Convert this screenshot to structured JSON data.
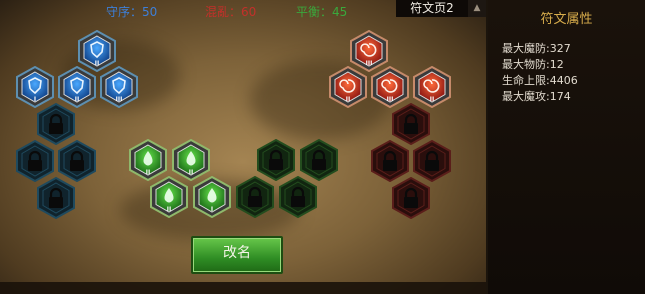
{
  "header": {
    "order_text": "守序：50",
    "chaos_text": "混亂：60",
    "balance_text": "平衡：45",
    "page_tab": "符文页2",
    "scroll_glyph": "▲"
  },
  "panel": {
    "title": "符文属性",
    "attributes": [
      {
        "text": "最大魔防:327"
      },
      {
        "text": "最大物防:12"
      },
      {
        "text": "生命上限:4406"
      },
      {
        "text": "最大魔攻:174"
      }
    ]
  },
  "button": {
    "rename": "改名"
  },
  "colors": {
    "order": "#3d7fd8",
    "chaos": "#c3302a",
    "balance": "#3aa83c",
    "panel_title": "#d8ad4c"
  },
  "slots": {
    "blue": [
      {
        "state": "rune",
        "rank": "II",
        "icon": "blue-shield-rune-icon"
      },
      {
        "state": "rune",
        "rank": "I",
        "icon": "blue-shield-rune-icon"
      },
      {
        "state": "rune",
        "rank": "II",
        "icon": "blue-shield-rune-icon"
      },
      {
        "state": "rune",
        "rank": "III",
        "icon": "blue-shield-rune-icon"
      },
      {
        "state": "locked",
        "icon": "lock-icon"
      },
      {
        "state": "locked",
        "icon": "lock-icon"
      },
      {
        "state": "locked",
        "icon": "lock-icon"
      },
      {
        "state": "locked",
        "icon": "lock-icon"
      }
    ],
    "green": [
      {
        "state": "rune",
        "rank": "II",
        "icon": "green-drop-rune-icon"
      },
      {
        "state": "rune",
        "rank": "II",
        "icon": "green-drop-rune-icon"
      },
      {
        "state": "rune",
        "rank": "II",
        "icon": "green-drop-rune-icon"
      },
      {
        "state": "rune",
        "rank": "I",
        "icon": "green-drop-rune-icon"
      },
      {
        "state": "locked",
        "icon": "lock-icon"
      },
      {
        "state": "locked",
        "icon": "lock-icon"
      },
      {
        "state": "locked",
        "icon": "lock-icon"
      },
      {
        "state": "locked",
        "icon": "lock-icon"
      }
    ],
    "red": [
      {
        "state": "rune",
        "rank": "III",
        "icon": "red-swirl-rune-icon"
      },
      {
        "state": "rune",
        "rank": "II",
        "icon": "red-swirl-rune-icon"
      },
      {
        "state": "rune",
        "rank": "III",
        "icon": "red-swirl-rune-icon"
      },
      {
        "state": "rune",
        "rank": "II",
        "icon": "red-swirl-rune-icon"
      },
      {
        "state": "locked",
        "icon": "lock-icon"
      },
      {
        "state": "locked",
        "icon": "lock-icon"
      },
      {
        "state": "locked",
        "icon": "lock-icon"
      },
      {
        "state": "locked",
        "icon": "lock-icon"
      }
    ]
  }
}
